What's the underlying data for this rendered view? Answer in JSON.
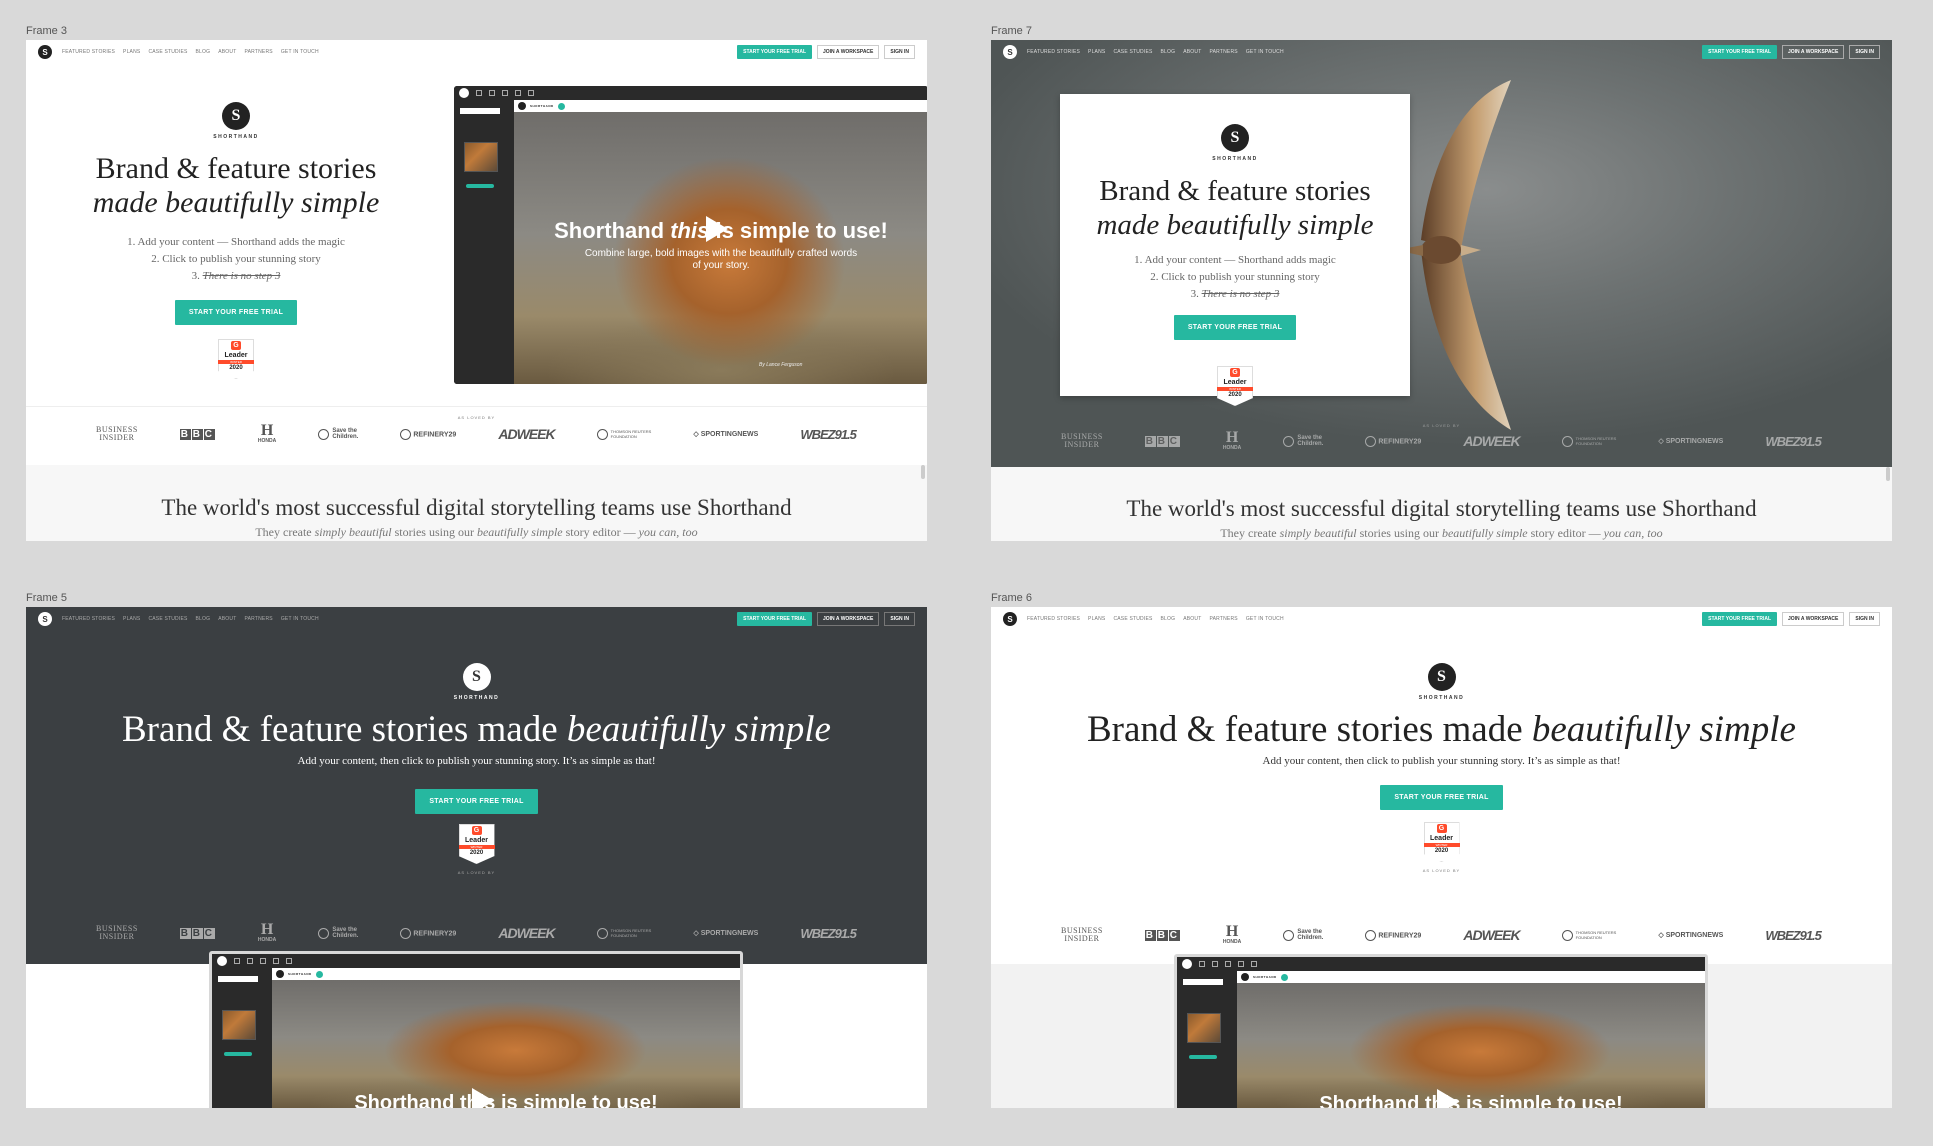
{
  "frames": [
    {
      "label": "Frame 3"
    },
    {
      "label": "Frame 7"
    },
    {
      "label": "Frame 5"
    },
    {
      "label": "Frame 6"
    }
  ],
  "nav": {
    "links": [
      "FEATURED STORIES",
      "PLANS",
      "CASE STUDIES",
      "BLOG",
      "ABOUT",
      "PARTNERS",
      "GET IN TOUCH"
    ],
    "trial": "START YOUR FREE TRIAL",
    "workspace": "JOIN A WORKSPACE",
    "signin": "SIGN IN",
    "logo_letter": "S"
  },
  "brand": {
    "letter": "S",
    "word": "SHORTHAND"
  },
  "hero": {
    "line1": "Brand & feature stories",
    "line2": "made beautifully simple",
    "wide_plain": "Brand & feature stories made ",
    "wide_italic": "beautifully simple",
    "step1": "1. Add your content — Shorthand adds the magic",
    "step1_alt": "1. Add your content — Shorthand adds magic",
    "step2": "2. Click to publish your stunning story",
    "step3_num": "3.",
    "step3_struck": "There is no step 3",
    "tagline": "Add your content, then click to publish your stunning story. It’s as simple as that!",
    "cta": "START YOUR FREE TRIAL"
  },
  "badge": {
    "g": "G",
    "leader": "Leader",
    "strip": "WINTER",
    "year": "2020"
  },
  "logos": {
    "loved": "AS LOVED BY",
    "business_insider_1": "BUSINESS",
    "business_insider_2": "INSIDER",
    "bbc": [
      "B",
      "B",
      "C"
    ],
    "honda": "HONDA",
    "save_children_1": "Save the",
    "save_children_2": "Children.",
    "refinery": "REFINERY29",
    "adweek": "ADWEEK",
    "thomson_1": "THOMSON REUTERS",
    "thomson_2": "FOUNDATION",
    "sportingnews": "SPORTINGNEWS",
    "wbez": "WBEZ91.5"
  },
  "editor": {
    "title_plain_a": "Shorthand ",
    "title_italic": "this",
    "title_plain_b": " is simple to use!",
    "sub1": "Combine large, bold images with the beautifully crafted words",
    "sub2": "of your story.",
    "byline": "By Lance Ferguson",
    "brand_word": "SHORTHAND",
    "cropped_title": "Shorthand this is simple to use!"
  },
  "section2": {
    "headline": "The world's most successful digital storytelling teams use Shorthand",
    "sub_a": "They create ",
    "sub_i1": "simply beautiful",
    "sub_b": " stories using our ",
    "sub_i2": "beautifully simple",
    "sub_c": " story editor — ",
    "sub_i3": "you can, too"
  },
  "colors": {
    "accent": "#26b8a0",
    "dark_bg": "#3b3f42",
    "badge_red": "#ff4b2b"
  }
}
